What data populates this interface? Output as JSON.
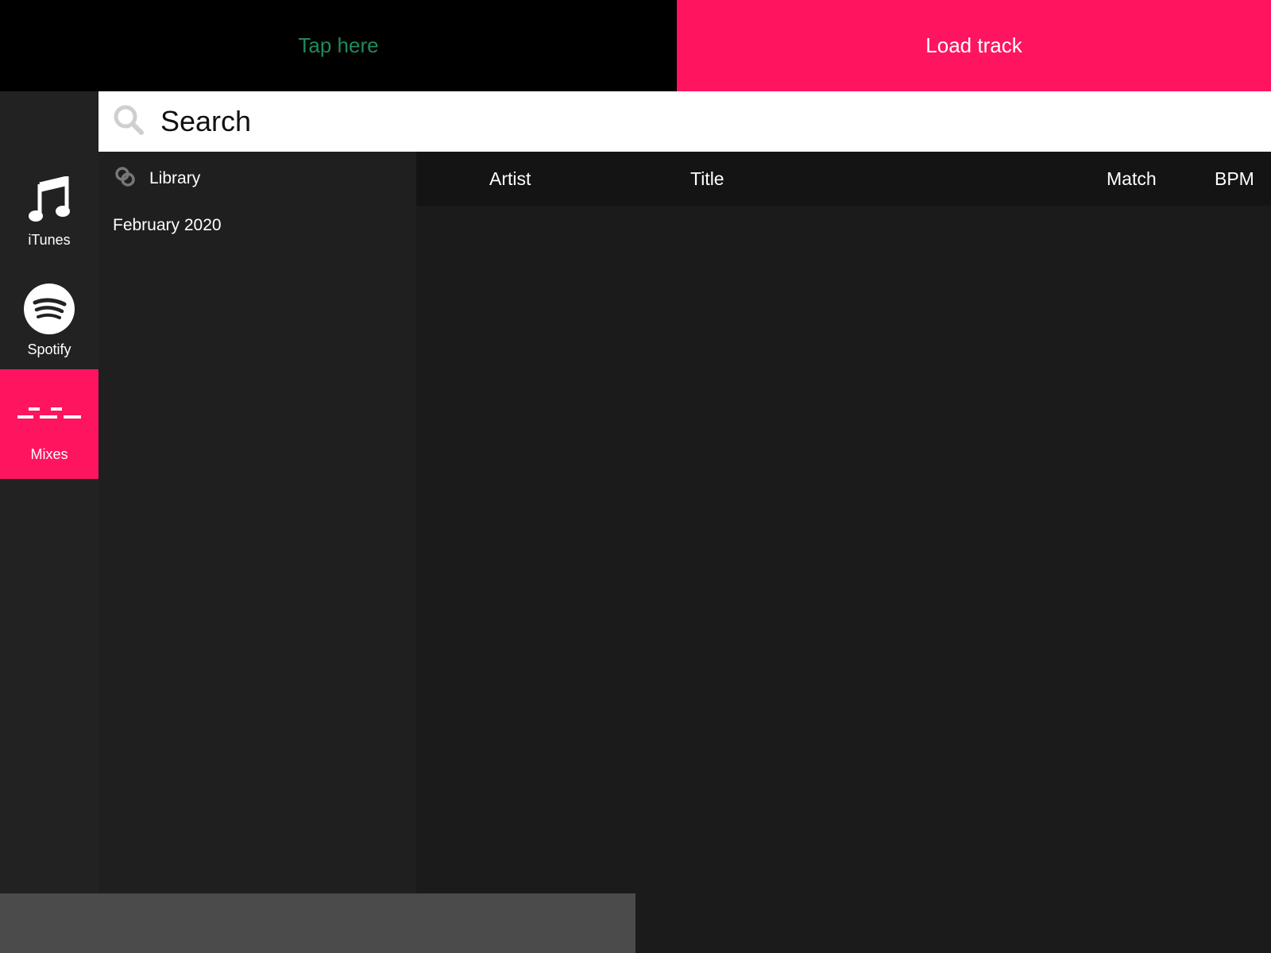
{
  "colors": {
    "accent": "#ff1460",
    "tap_text": "#1f8a5b"
  },
  "topbar": {
    "tap_label": "Tap here",
    "load_label": "Load track"
  },
  "sources": [
    {
      "label": "iTunes",
      "icon": "music-note-icon"
    },
    {
      "label": "Spotify",
      "icon": "spotify-icon"
    },
    {
      "label": "Mixes",
      "icon": "mixes-icon"
    }
  ],
  "search": {
    "placeholder": "Search",
    "icon": "search-icon"
  },
  "browser": {
    "header_label": "Library",
    "header_icon": "library-icon",
    "folders": [
      "February 2020"
    ]
  },
  "tracklist": {
    "columns": [
      "Artist",
      "Title",
      "Match",
      "BPM"
    ]
  }
}
